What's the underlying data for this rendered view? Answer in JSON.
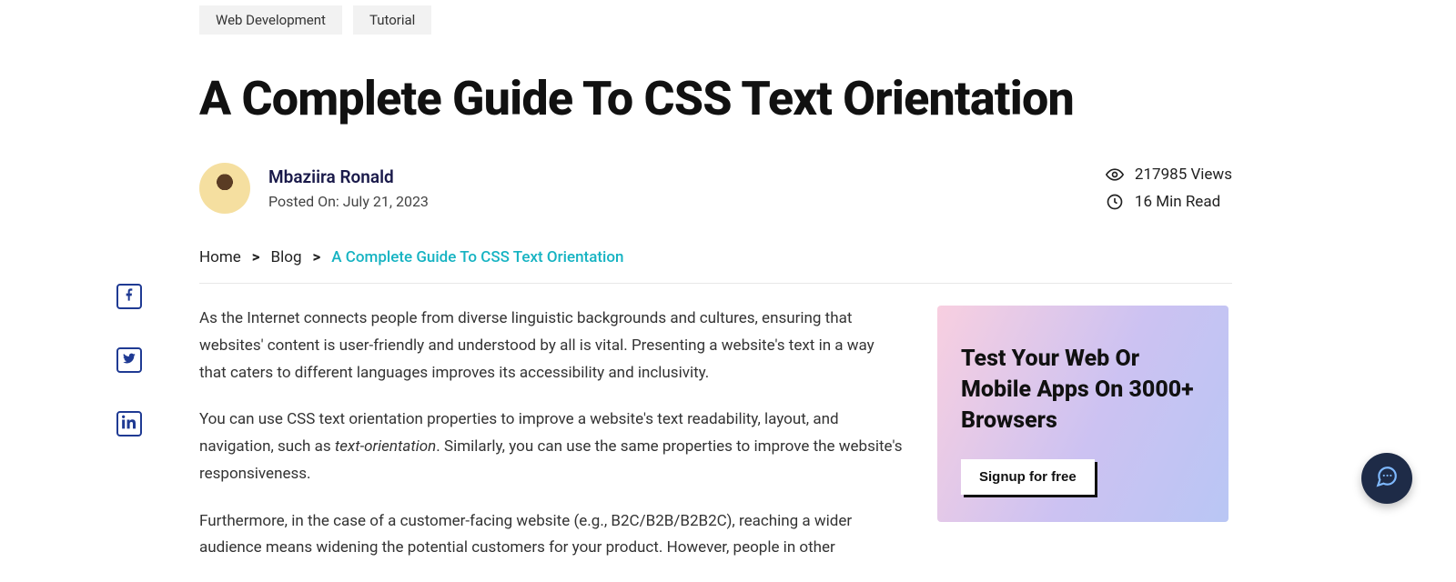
{
  "tags": [
    "Web Development",
    "Tutorial"
  ],
  "title": "A Complete Guide To CSS Text Orientation",
  "author": {
    "name": "Mbaziira Ronald",
    "posted_on": "Posted On: July 21, 2023"
  },
  "stats": {
    "views": "217985 Views",
    "read": "16 Min Read"
  },
  "breadcrumb": {
    "home": "Home",
    "blog": "Blog",
    "current": "A Complete Guide To CSS Text Orientation"
  },
  "article": {
    "p1": "As the Internet connects people from diverse linguistic backgrounds and cultures, ensuring that websites' content is user-friendly and understood by all is vital. Presenting a website's text in a way that caters to different languages improves its accessibility and inclusivity.",
    "p2_a": "You can use CSS text orientation properties to improve a website's text readability, layout, and navigation, such as ",
    "p2_em": "text-orientation",
    "p2_b": ". Similarly, you can use the same properties to improve the website's responsiveness.",
    "p3": "Furthermore, in the case of a customer-facing website (e.g., B2C/B2B/B2B2C), reaching a wider audience means widening the potential customers for your product. However, people in other"
  },
  "promo": {
    "heading": "Test Your Web Or Mobile Apps On 3000+ Browsers",
    "cta": "Signup for free"
  },
  "icons": {
    "facebook": "facebook-icon",
    "twitter": "twitter-icon",
    "linkedin": "linkedin-icon",
    "eye": "eye-icon",
    "clock": "clock-icon",
    "chat": "chat-icon"
  }
}
